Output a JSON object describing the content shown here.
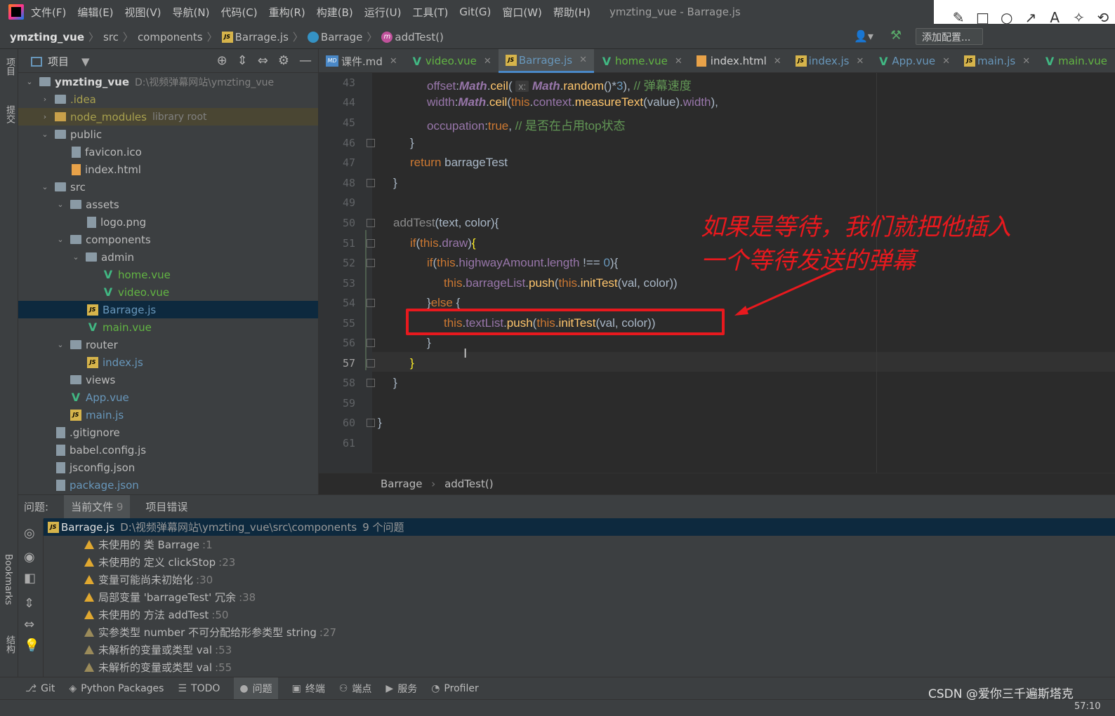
{
  "menubar": {
    "items": [
      "文件(F)",
      "编辑(E)",
      "视图(V)",
      "导航(N)",
      "代码(C)",
      "重构(R)",
      "构建(B)",
      "运行(U)",
      "工具(T)",
      "Git(G)",
      "窗口(W)",
      "帮助(H)"
    ],
    "window_title": "ymzting_vue - Barrage.js"
  },
  "annot_toolbar": {
    "tools": [
      "✎",
      "□",
      "○",
      "↗",
      "A",
      "✧",
      "⟲"
    ]
  },
  "navbar": {
    "project": "ymzting_vue",
    "crumbs": [
      "src",
      "components",
      "Barrage.js",
      "Barrage",
      "addTest()"
    ],
    "run_config": "添加配置..."
  },
  "left_strip": {
    "project_label": "项目",
    "commit_label": "提交",
    "bookmarks_label": "Bookmarks",
    "structure_label": "结构"
  },
  "project_panel": {
    "title": "项目",
    "tree": [
      {
        "label": "ymzting_vue",
        "extra": "D:\\视频弹幕网站\\ymzting_vue"
      },
      {
        "label": ".idea"
      },
      {
        "label": "node_modules",
        "extra": "library root"
      },
      {
        "label": "public"
      },
      {
        "label": "favicon.ico"
      },
      {
        "label": "index.html"
      },
      {
        "label": "src"
      },
      {
        "label": "assets"
      },
      {
        "label": "logo.png"
      },
      {
        "label": "components"
      },
      {
        "label": "admin"
      },
      {
        "label": "home.vue"
      },
      {
        "label": "video.vue"
      },
      {
        "label": "Barrage.js"
      },
      {
        "label": "main.vue"
      },
      {
        "label": "router"
      },
      {
        "label": "index.js"
      },
      {
        "label": "views"
      },
      {
        "label": "App.vue"
      },
      {
        "label": "main.js"
      },
      {
        "label": ".gitignore"
      },
      {
        "label": "babel.config.js"
      },
      {
        "label": "jsconfig.json"
      },
      {
        "label": "package.json"
      }
    ]
  },
  "tabs": [
    "课件.md",
    "video.vue",
    "Barrage.js",
    "home.vue",
    "index.html",
    "index.js",
    "App.vue",
    "main.js",
    "main.vue"
  ],
  "editor": {
    "line_numbers": [
      "43",
      "44",
      "45",
      "46",
      "47",
      "48",
      "49",
      "50",
      "51",
      "52",
      "53",
      "54",
      "55",
      "56",
      "57",
      "58",
      "59",
      "60",
      "61"
    ],
    "breadcrumb": [
      "Barrage",
      "addTest()"
    ]
  },
  "annotation": {
    "line1": "如果是等待，我们就把他插入",
    "line2": "一个等待发送的弹幕"
  },
  "problems": {
    "tabs": {
      "label": "问题:",
      "current": "当前文件",
      "current_count": "9",
      "project": "项目错误"
    },
    "file": {
      "name": "Barrage.js",
      "path": "D:\\视频弹幕网站\\ymzting_vue\\src\\components",
      "count": "9 个问题"
    },
    "items": [
      {
        "text": "未使用的 类 Barrage",
        "line": ":1"
      },
      {
        "text": "未使用的 定义 clickStop",
        "line": ":23"
      },
      {
        "text": "变量可能尚未初始化",
        "line": ":30"
      },
      {
        "text": "局部变量 'barrageTest' 冗余",
        "line": ":38"
      },
      {
        "text": "未使用的 方法 addTest",
        "line": ":50"
      },
      {
        "text": "实参类型 number 不可分配给形参类型 string",
        "line": ":27"
      },
      {
        "text": "未解析的变量或类型 val",
        "line": ":53"
      },
      {
        "text": "未解析的变量或类型 val",
        "line": ":55"
      }
    ]
  },
  "bottombar": [
    "Git",
    "Python Packages",
    "TODO",
    "问题",
    "终端",
    "端点",
    "服务",
    "Profiler"
  ],
  "watermark": "CSDN @爱你三千遍斯塔克",
  "clock": "57:10"
}
